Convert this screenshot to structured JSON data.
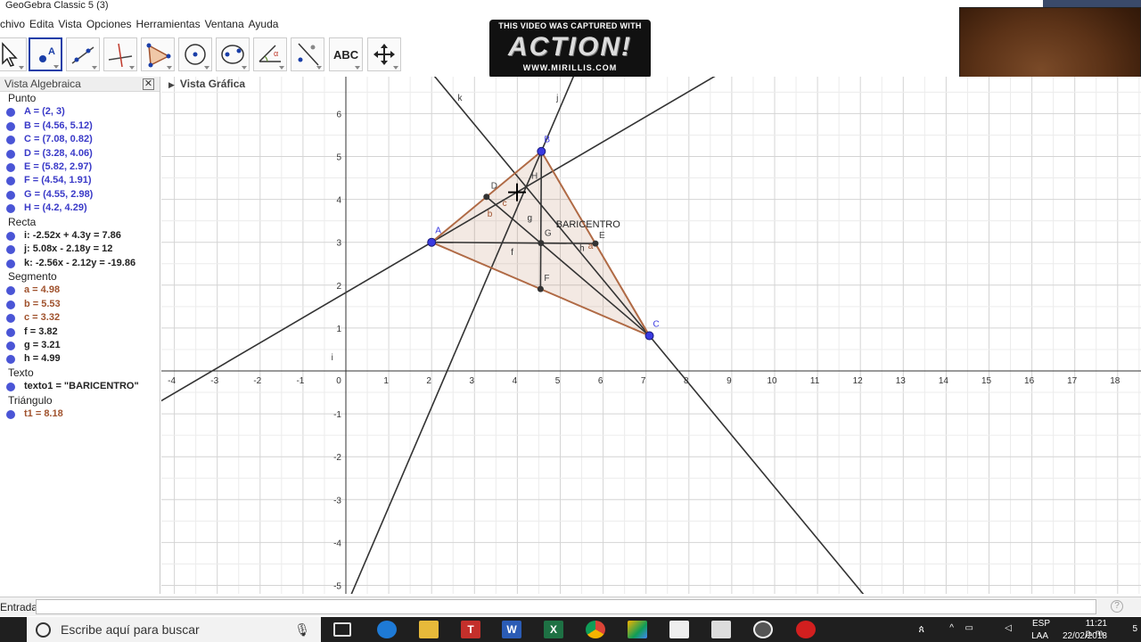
{
  "window": {
    "title": "GeoGebra Classic 5 (3)"
  },
  "menu": [
    "chivo",
    "Edita",
    "Vista",
    "Opciones",
    "Herramientas",
    "Ventana",
    "Ayuda"
  ],
  "toolbar": {
    "tools": [
      "move-tool",
      "point-tool",
      "line-tool",
      "perpendicular-tool",
      "polygon-tool",
      "circle-tool",
      "conic-tool",
      "angle-tool",
      "reflect-tool",
      "text-tool",
      "move-view-tool"
    ],
    "text_tool_label": "ABC",
    "selected": "point-tool"
  },
  "watermark": {
    "line1": "THIS VIDEO WAS CAPTURED WITH",
    "brand": "ACTION!",
    "url": "WWW.MIRILLIS.COM"
  },
  "algebra": {
    "title": "Vista Algebraica",
    "categories": [
      {
        "name": "Punto",
        "color": "#3a3ac8",
        "items": [
          "A = (2, 3)",
          "B = (4.56, 5.12)",
          "C = (7.08, 0.82)",
          "D = (3.28, 4.06)",
          "E = (5.82, 2.97)",
          "F = (4.54, 1.91)",
          "G = (4.55, 2.98)",
          "H = (4.2, 4.29)"
        ]
      },
      {
        "name": "Recta",
        "color": "#222222",
        "items": [
          "i: -2.52x + 4.3y = 7.86",
          "j: 5.08x - 2.18y = 12",
          "k: -2.56x - 2.12y = -19.86"
        ]
      },
      {
        "name": "Segmento",
        "color": "#a0522d",
        "items": [
          "a = 4.98",
          "b = 5.53",
          "c = 3.32",
          "f = 3.82",
          "g = 3.21",
          "h = 4.99"
        ]
      },
      {
        "name": "Texto",
        "color": "#222222",
        "items": [
          "texto1 = \"BARICENTRO\""
        ]
      },
      {
        "name": "Triángulo",
        "color": "#a0522d",
        "items": [
          "t1 = 8.18"
        ]
      }
    ],
    "item_colors": {
      "Segmento": [
        "#a0522d",
        "#a0522d",
        "#a0522d",
        "#222222",
        "#222222",
        "#222222"
      ]
    }
  },
  "graphics": {
    "title": "Vista Gráfica",
    "text_label": "BARICENTRO",
    "x_ticks": [
      -4,
      -3,
      -2,
      -1,
      0,
      1,
      2,
      3,
      4,
      5,
      6,
      7,
      8,
      9,
      10,
      11,
      12,
      13,
      14,
      15,
      16,
      17,
      18
    ],
    "y_ticks": [
      -5,
      -4,
      -3,
      -2,
      -1,
      0,
      1,
      2,
      3,
      4,
      5,
      6
    ],
    "points": [
      {
        "name": "A",
        "x": 2,
        "y": 3,
        "kind": "free"
      },
      {
        "name": "B",
        "x": 4.56,
        "y": 5.12,
        "kind": "free"
      },
      {
        "name": "C",
        "x": 7.08,
        "y": 0.82,
        "kind": "free"
      },
      {
        "name": "D",
        "x": 3.28,
        "y": 4.06,
        "kind": "dependent"
      },
      {
        "name": "E",
        "x": 5.82,
        "y": 2.97,
        "kind": "dependent"
      },
      {
        "name": "F",
        "x": 4.54,
        "y": 1.91,
        "kind": "dependent"
      },
      {
        "name": "G",
        "x": 4.55,
        "y": 2.98,
        "kind": "dependent"
      },
      {
        "name": "H",
        "x": 4.2,
        "y": 4.29,
        "kind": "label"
      }
    ],
    "lines": [
      {
        "name": "i",
        "a": -2.52,
        "b": 4.3,
        "c": 7.86
      },
      {
        "name": "j",
        "a": 5.08,
        "b": -2.18,
        "c": 12
      },
      {
        "name": "k",
        "a": -2.56,
        "b": -2.12,
        "c": -19.86
      }
    ],
    "segment_labels": [
      "a",
      "b",
      "c",
      "f",
      "g",
      "h"
    ],
    "colors": {
      "triangle": "#b06a45",
      "fill": "rgba(176,106,69,0.15)",
      "free_point": "#3a3ae0",
      "grid_major": "#d4d4d4",
      "grid_minor": "#ececec"
    }
  },
  "input_bar": {
    "label": "Entrada:"
  },
  "taskbar": {
    "search_placeholder": "Escribe aquí para buscar",
    "lang": "ESP",
    "lang_sub": "LAA",
    "time": "11:21 p. m.",
    "date": "22/02/2018",
    "notif": "5"
  }
}
